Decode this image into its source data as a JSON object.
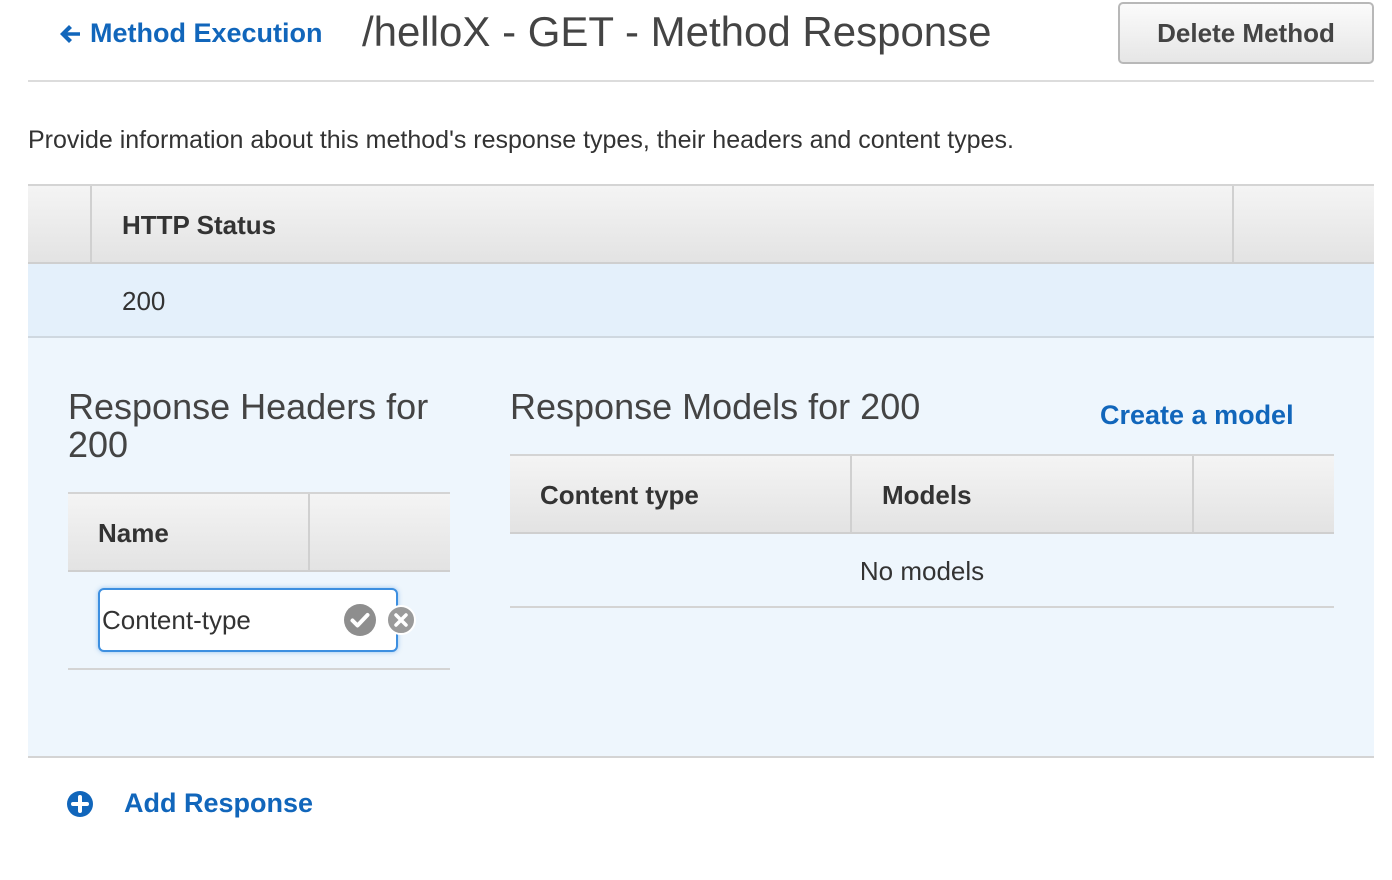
{
  "header": {
    "back_label": "Method Execution",
    "title": "/helloX - GET - Method Response",
    "delete_label": "Delete Method"
  },
  "description": "Provide information about this method's response types, their headers and content types.",
  "responses_table": {
    "column_http_status": "HTTP Status",
    "rows": [
      {
        "status": "200"
      }
    ]
  },
  "response_headers": {
    "title": "Response Headers for 200",
    "column_name": "Name",
    "name_input_value": "Content-type"
  },
  "response_models": {
    "title": "Response Models for 200",
    "create_label": "Create a model",
    "column_content_type": "Content type",
    "column_models": "Models",
    "empty_text": "No models"
  },
  "add_response_label": "Add Response",
  "colors": {
    "link": "#1166bb",
    "selected_row": "#e4f0fb",
    "detail_bg": "#eef6fd",
    "focus_border": "#3d8fe0"
  }
}
